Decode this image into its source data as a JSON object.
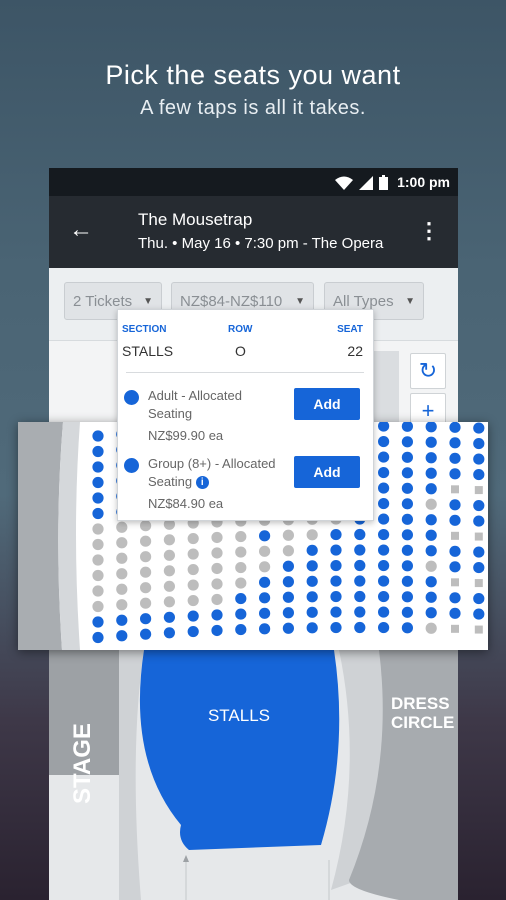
{
  "promo": {
    "title": "Pick the seats you want",
    "subtitle": "A few taps is all it takes."
  },
  "status_bar": {
    "time": "1:00 pm",
    "icons": [
      "wifi-icon",
      "signal-icon",
      "battery-icon"
    ]
  },
  "toolbar": {
    "title": "The Mousetrap",
    "subtitle": "Thu. • May 16 • 7:30 pm - The Opera",
    "back_icon": "back-arrow-icon",
    "menu_icon": "more-vert-icon"
  },
  "filters": [
    {
      "label": "2 Tickets"
    },
    {
      "label": "NZ$84-NZ$110"
    },
    {
      "label": "All Types"
    }
  ],
  "seat_popup": {
    "section_label": "SECTION",
    "section_value": "STALLS",
    "row_label": "ROW",
    "row_value": "O",
    "seat_label": "SEAT",
    "seat_value": "22",
    "offers": [
      {
        "type": "Adult - Allocated Seating",
        "price": "NZ$99.90 ea",
        "button": "Add"
      },
      {
        "type": "Group (8+) - Allocated Seating",
        "price": "NZ$84.90 ea",
        "button": "Add",
        "info_icon": "i"
      }
    ]
  },
  "overview_map": {
    "stage_label": "STAGE",
    "stalls_label": "STALLS",
    "dress_circle_label": "DRESS CIRCLE"
  },
  "colors": {
    "accent": "#1665d8",
    "seat_available": "#1665d8",
    "seat_unavailable": "#bdbdbd"
  }
}
